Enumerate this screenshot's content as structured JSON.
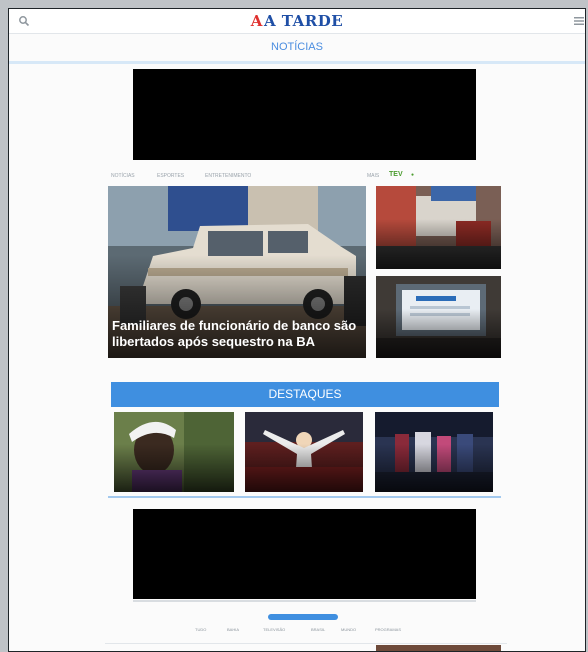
{
  "header": {
    "logo_mark": "A",
    "logo_text": "A TARDE",
    "search_icon": "search-icon",
    "menu_icon": "menu-icon"
  },
  "section": {
    "title": "NOTÍCIAS"
  },
  "subnav": {
    "items": [
      "NOTÍCIAS",
      "ESPORTES",
      "ENTRETENIMENTO"
    ],
    "right_label": "MAIS",
    "badge": "TEV",
    "badge_dot": "●"
  },
  "featured": {
    "hero_caption": "Familiares de funcionário de banco são libertados após sequestro na BA",
    "side_top_caption": "",
    "side_bottom_caption": ""
  },
  "destaques": {
    "title": "DESTAQUES",
    "cards": [
      {
        "caption": ""
      },
      {
        "caption": ""
      },
      {
        "caption": ""
      }
    ]
  },
  "tabs": {
    "pill_label": "",
    "items": [
      "TUDO",
      "BAHIA",
      "TELEVISÃO",
      "BRASIL",
      "MUNDO",
      "PROGRAMAS"
    ]
  },
  "colors": {
    "brand_blue": "#3f8fe0",
    "logo_blue": "#1f4fa6",
    "logo_red": "#e0312f"
  }
}
